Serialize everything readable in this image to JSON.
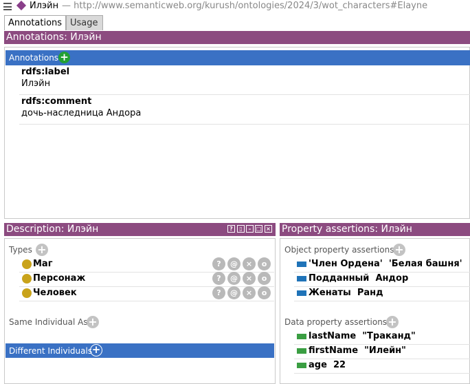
{
  "title": {
    "individual": "Илэйн",
    "iri": "— http://www.semanticweb.org/kurush/ontologies/2024/3/wot_characters#Elayne"
  },
  "tabs": [
    {
      "label": "Annotations"
    },
    {
      "label": "Usage"
    }
  ],
  "annotations": {
    "header": "Annotations: Илэйн",
    "bar_label": "Annotations",
    "items": [
      {
        "property": "rdfs:label",
        "value": "Илэйн"
      },
      {
        "property": "rdfs:comment",
        "value": "дочь-наследница Андора"
      }
    ]
  },
  "description": {
    "header": "Description: Илэйн",
    "types_label": "Types",
    "types": [
      {
        "label": "Маг"
      },
      {
        "label": "Персонаж"
      },
      {
        "label": "Человек"
      }
    ],
    "same_individual_label": "Same Individual As",
    "different_individuals_label": "Different Individuals"
  },
  "property_assertions": {
    "header": "Property assertions: Илэйн",
    "object_label": "Object property assertions",
    "object_rows": [
      {
        "property": "'Член Ордена'",
        "value": "'Белая башня'"
      },
      {
        "property": "Подданный",
        "value": "Андор"
      },
      {
        "property": "Женаты",
        "value": "Ранд"
      }
    ],
    "data_label": "Data property assertions",
    "data_rows": [
      {
        "property": "lastName",
        "value": "\"Траканд\""
      },
      {
        "property": "firstName",
        "value": "\"Илейн\""
      },
      {
        "property": "age",
        "value": "22"
      }
    ]
  },
  "colors": {
    "header_purple": "#8c4b80",
    "selection_blue": "#3a71c4",
    "class_dot": "#c9a31a",
    "object_property": "#1f73b8",
    "data_property": "#3a9e42",
    "add_green": "#22a032"
  },
  "icons": {
    "menu": "hamburger-icon",
    "individual": "diamond-icon",
    "row_buttons": [
      "question-icon",
      "at-icon",
      "delete-icon",
      "edit-icon"
    ]
  }
}
